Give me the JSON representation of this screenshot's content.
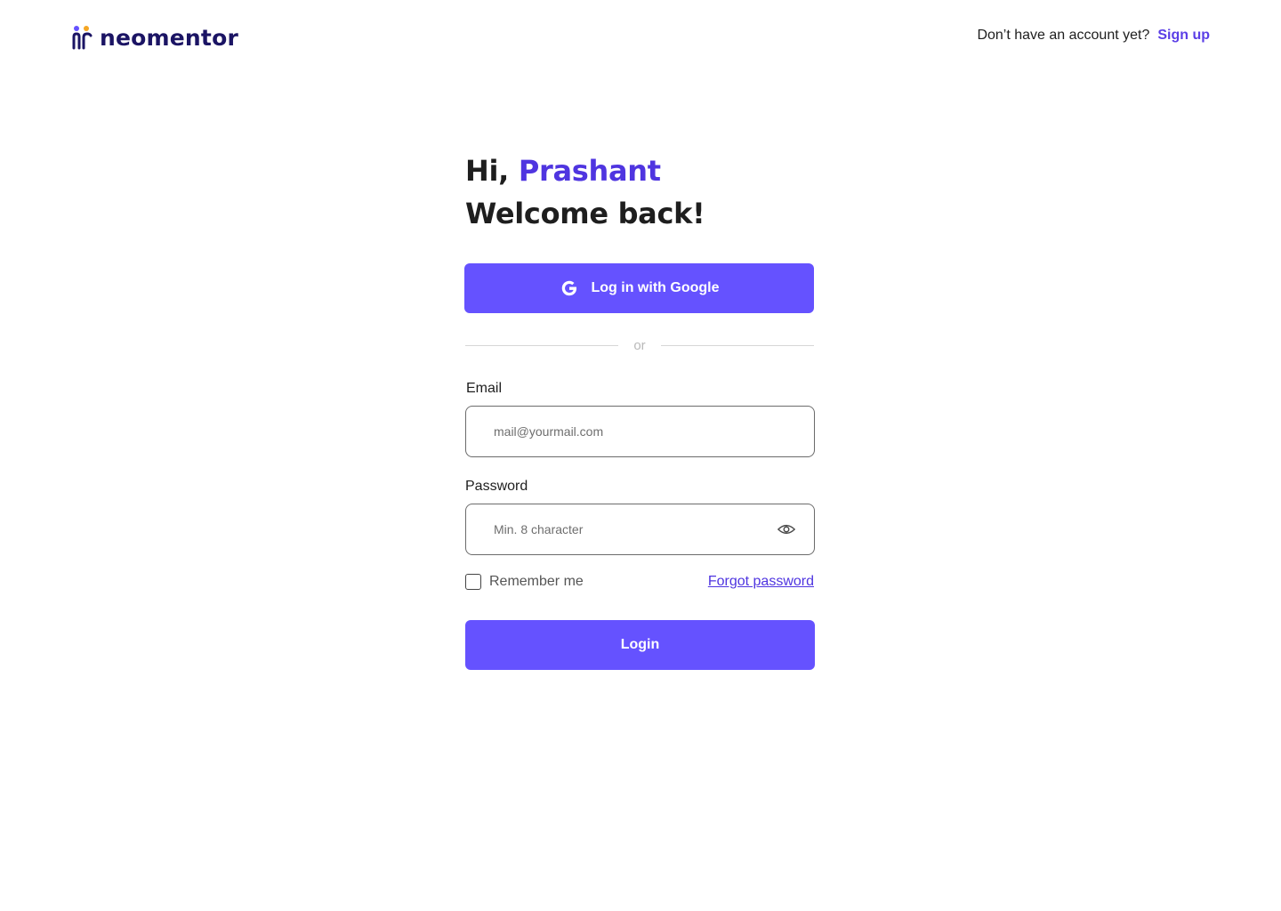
{
  "brand": {
    "name": "neomentor",
    "colors": {
      "primary": "#6552FF",
      "accent_text": "#4F35E0",
      "logo_text": "#1B1464",
      "logo_dot_left": "#6552FF",
      "logo_dot_right": "#F5A623"
    }
  },
  "header": {
    "prompt": "Don’t have an account yet?",
    "signup_label": "Sign up"
  },
  "greeting": {
    "hi": "Hi,",
    "name": "Prashant",
    "welcome": "Welcome back!"
  },
  "google_button": {
    "label": "Log in with Google",
    "icon": "google-g-icon"
  },
  "divider": {
    "text": "or"
  },
  "email": {
    "label": "Email",
    "placeholder": "mail@yourmail.com",
    "value": ""
  },
  "password": {
    "label": "Password",
    "placeholder": "Min. 8 character",
    "value": "",
    "toggle_icon": "eye-icon"
  },
  "options": {
    "remember_label": "Remember me",
    "remember_checked": false,
    "forgot_label": "Forgot password"
  },
  "login_button": {
    "label": "Login"
  }
}
